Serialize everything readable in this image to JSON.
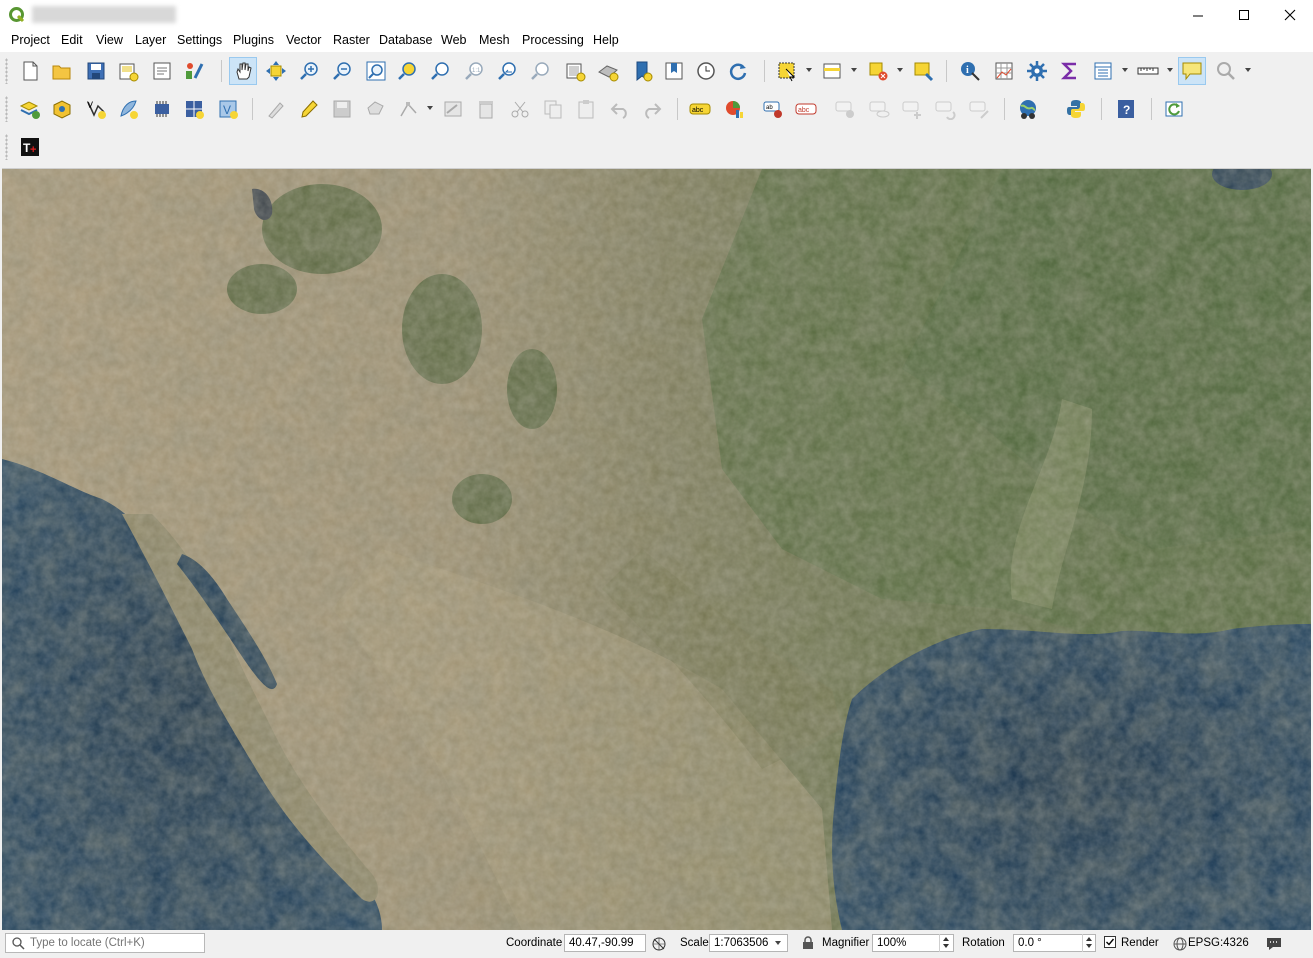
{
  "window": {
    "title": "— —  — —————  ·  ———",
    "controls": {
      "minimize": "—",
      "maximize": "☐",
      "close": "✕"
    }
  },
  "menu": [
    "Project",
    "Edit",
    "View",
    "Layer",
    "Settings",
    "Plugins",
    "Vector",
    "Raster",
    "Database",
    "Web",
    "Mesh",
    "Processing",
    "Help"
  ],
  "toolbar1_icons": [
    "new-project",
    "open-project",
    "save-project",
    "new-print-layout",
    "show-layout-manager",
    "style-manager",
    "pan-map",
    "pan-to-selection",
    "zoom-in",
    "zoom-out",
    "zoom-full",
    "zoom-to-selection",
    "zoom-to-layer",
    "zoom-to-native-resolution",
    "zoom-last",
    "zoom-next",
    "new-map-view",
    "new-3d-map-view",
    "new-spatial-bookmark",
    "show-bookmarks",
    "temporal-controller",
    "refresh",
    "select-features",
    "open-attribute-table-selection",
    "deselect-all",
    "select-by-location",
    "identify-features",
    "open-attribute-table",
    "toolbox",
    "statistical-summary",
    "field-calculator",
    "measure-line",
    "show-map-tips",
    "locator-search"
  ],
  "toolbar2_icons": [
    "data-source-manager",
    "new-geopackage-layer",
    "new-shapefile-layer",
    "new-spatialite-layer",
    "new-virtual-layer",
    "new-temporary-layer",
    "new-mesh-layer",
    "current-edits",
    "toggle-editing",
    "save-layer-edits",
    "add-polygon-feature",
    "vertex-tool",
    "modify-attributes",
    "delete-selected",
    "cut-features",
    "copy-features",
    "paste-features",
    "undo",
    "redo",
    "layer-labeling",
    "layer-diagram",
    "highlight-pinned-labels",
    "toggle-display-labels",
    "pin-labels",
    "show-hide-labels",
    "move-label",
    "rotate-label",
    "change-label",
    "osm-plugin",
    "python-console",
    "help-contents",
    "plugin-reloader"
  ],
  "toolbar3_icons": [
    "t-plus-plugin"
  ],
  "statusbar": {
    "locator_placeholder": "Type to locate (Ctrl+K)",
    "coordinate_label": "Coordinate",
    "coordinate_value": "40.47,-90.99",
    "scale_label": "Scale",
    "scale_value": "1:7063506",
    "magnifier_label": "Magnifier",
    "magnifier_value": "100%",
    "rotation_label": "Rotation",
    "rotation_value": "0.0 °",
    "render_label": "Render",
    "render_checked": true,
    "crs_label": "EPSG:4326"
  },
  "colors": {
    "ocean": "#0e2b47",
    "land_desert": "#b8a784",
    "land_green": "#4f6638",
    "accent_yellow": "#f6d535",
    "accent_blue": "#2f6fb0"
  }
}
